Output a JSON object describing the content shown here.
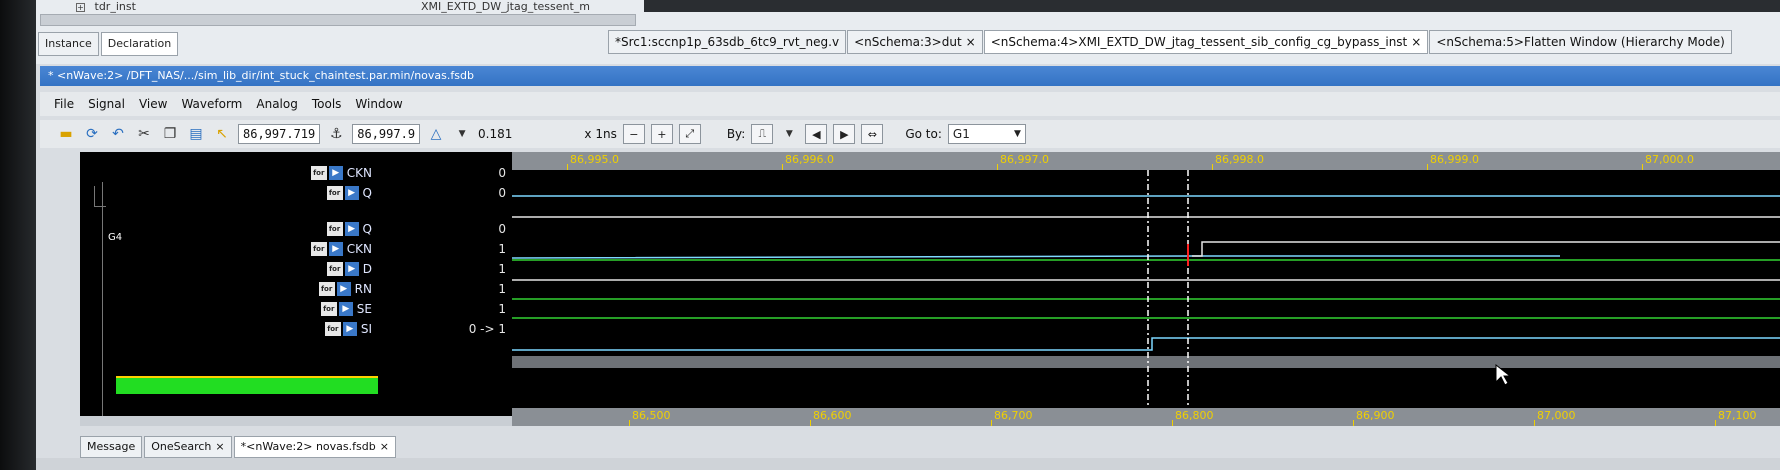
{
  "top": {
    "tree_item": "tdr_inst",
    "tree_item_right": "XMI_EXTD_DW_jtag_tessent_m"
  },
  "panel_tabs": [
    {
      "label": "Instance",
      "active": false
    },
    {
      "label": "Declaration",
      "active": true
    }
  ],
  "schema_tabs": [
    {
      "label": "*Src1:sccnp1p_63sdb_6tc9_rvt_neg.v",
      "active": false,
      "close": false
    },
    {
      "label": "<nSchema:3>dut",
      "active": false,
      "close": true
    },
    {
      "label": "<nSchema:4>XMI_EXTD_DW_jtag_tessent_sib_config_cg_bypass_inst",
      "active": true,
      "close": true
    },
    {
      "label": "<nSchema:5>Flatten Window (Hierarchy Mode)",
      "active": false,
      "close": false
    }
  ],
  "close_glyph": "×",
  "window_title": "* <nWave:2> /DFT_NAS/.../sim_lib_dir/int_stuck_chaintest.par.min/novas.fsdb",
  "menu": [
    "File",
    "Signal",
    "View",
    "Waveform",
    "Analog",
    "Tools",
    "Window"
  ],
  "toolbar": {
    "cursor_time": "86,997.719",
    "marker_time": "86,997.9",
    "delta": "0.181",
    "zoom_unit": "x 1ns",
    "by_label": "By:",
    "goto_label": "Go to:",
    "goto_value": "G1"
  },
  "signals": [
    {
      "name": "CKN",
      "value": "0"
    },
    {
      "name": "Q",
      "value": "0"
    },
    {
      "name": "Q",
      "value": "0"
    },
    {
      "name": "CKN",
      "value": "1"
    },
    {
      "name": "D",
      "value": "1"
    },
    {
      "name": "RN",
      "value": "1"
    },
    {
      "name": "SE",
      "value": "1"
    },
    {
      "name": "SI",
      "value": "0 -> 1"
    }
  ],
  "signal_badge": "for",
  "group_label": "G4",
  "ruler_top": [
    "86,995.0",
    "86,996.0",
    "86,997.0",
    "86,998.0",
    "86,999.0",
    "87,000.0"
  ],
  "ruler_bottom": [
    "86,500",
    "86,600",
    "86,700",
    "86,800",
    "86,900",
    "87,000",
    "87,100"
  ],
  "colors": {
    "cyan": "#7ed8ff",
    "green": "#32d232",
    "white": "#e6e6e6",
    "cursor_red": "#ff2020",
    "ruler_text": "#f0d000"
  },
  "bottom_tabs": [
    {
      "label": "Message",
      "active": false,
      "close": false
    },
    {
      "label": "OneSearch",
      "active": false,
      "close": true
    },
    {
      "label": "*<nWave:2> novas.fsdb",
      "active": true,
      "close": true
    }
  ]
}
